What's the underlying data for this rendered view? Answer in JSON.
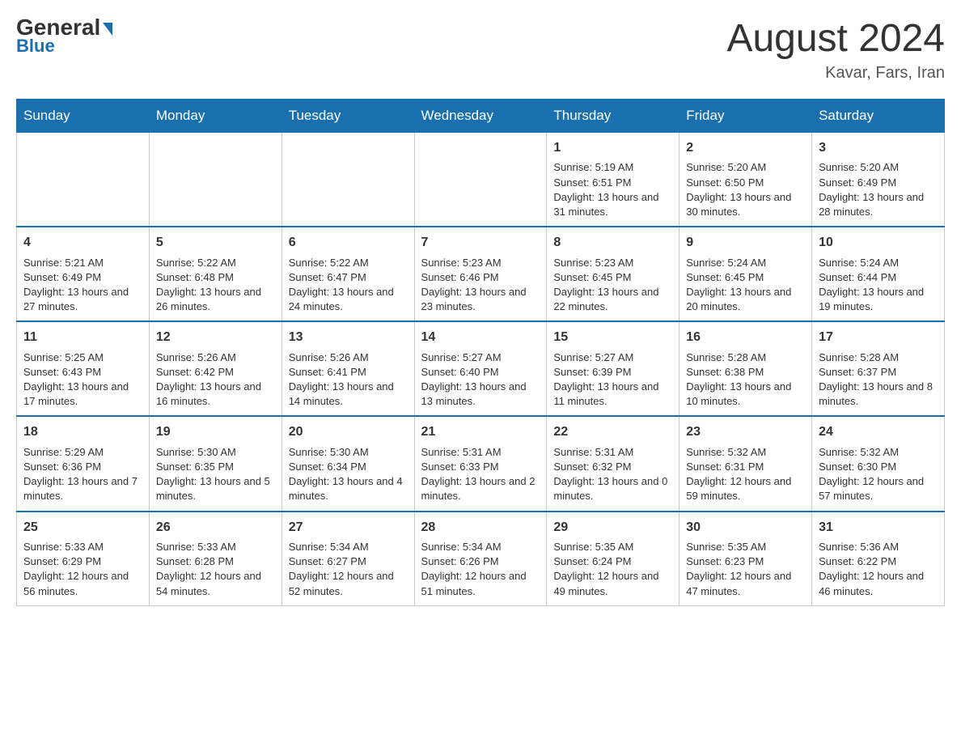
{
  "header": {
    "logo_general": "General",
    "logo_blue": "Blue",
    "month_title": "August 2024",
    "location": "Kavar, Fars, Iran"
  },
  "weekdays": [
    "Sunday",
    "Monday",
    "Tuesday",
    "Wednesday",
    "Thursday",
    "Friday",
    "Saturday"
  ],
  "weeks": [
    [
      {
        "day": "",
        "info": ""
      },
      {
        "day": "",
        "info": ""
      },
      {
        "day": "",
        "info": ""
      },
      {
        "day": "",
        "info": ""
      },
      {
        "day": "1",
        "info": "Sunrise: 5:19 AM\nSunset: 6:51 PM\nDaylight: 13 hours and 31 minutes."
      },
      {
        "day": "2",
        "info": "Sunrise: 5:20 AM\nSunset: 6:50 PM\nDaylight: 13 hours and 30 minutes."
      },
      {
        "day": "3",
        "info": "Sunrise: 5:20 AM\nSunset: 6:49 PM\nDaylight: 13 hours and 28 minutes."
      }
    ],
    [
      {
        "day": "4",
        "info": "Sunrise: 5:21 AM\nSunset: 6:49 PM\nDaylight: 13 hours and 27 minutes."
      },
      {
        "day": "5",
        "info": "Sunrise: 5:22 AM\nSunset: 6:48 PM\nDaylight: 13 hours and 26 minutes."
      },
      {
        "day": "6",
        "info": "Sunrise: 5:22 AM\nSunset: 6:47 PM\nDaylight: 13 hours and 24 minutes."
      },
      {
        "day": "7",
        "info": "Sunrise: 5:23 AM\nSunset: 6:46 PM\nDaylight: 13 hours and 23 minutes."
      },
      {
        "day": "8",
        "info": "Sunrise: 5:23 AM\nSunset: 6:45 PM\nDaylight: 13 hours and 22 minutes."
      },
      {
        "day": "9",
        "info": "Sunrise: 5:24 AM\nSunset: 6:45 PM\nDaylight: 13 hours and 20 minutes."
      },
      {
        "day": "10",
        "info": "Sunrise: 5:24 AM\nSunset: 6:44 PM\nDaylight: 13 hours and 19 minutes."
      }
    ],
    [
      {
        "day": "11",
        "info": "Sunrise: 5:25 AM\nSunset: 6:43 PM\nDaylight: 13 hours and 17 minutes."
      },
      {
        "day": "12",
        "info": "Sunrise: 5:26 AM\nSunset: 6:42 PM\nDaylight: 13 hours and 16 minutes."
      },
      {
        "day": "13",
        "info": "Sunrise: 5:26 AM\nSunset: 6:41 PM\nDaylight: 13 hours and 14 minutes."
      },
      {
        "day": "14",
        "info": "Sunrise: 5:27 AM\nSunset: 6:40 PM\nDaylight: 13 hours and 13 minutes."
      },
      {
        "day": "15",
        "info": "Sunrise: 5:27 AM\nSunset: 6:39 PM\nDaylight: 13 hours and 11 minutes."
      },
      {
        "day": "16",
        "info": "Sunrise: 5:28 AM\nSunset: 6:38 PM\nDaylight: 13 hours and 10 minutes."
      },
      {
        "day": "17",
        "info": "Sunrise: 5:28 AM\nSunset: 6:37 PM\nDaylight: 13 hours and 8 minutes."
      }
    ],
    [
      {
        "day": "18",
        "info": "Sunrise: 5:29 AM\nSunset: 6:36 PM\nDaylight: 13 hours and 7 minutes."
      },
      {
        "day": "19",
        "info": "Sunrise: 5:30 AM\nSunset: 6:35 PM\nDaylight: 13 hours and 5 minutes."
      },
      {
        "day": "20",
        "info": "Sunrise: 5:30 AM\nSunset: 6:34 PM\nDaylight: 13 hours and 4 minutes."
      },
      {
        "day": "21",
        "info": "Sunrise: 5:31 AM\nSunset: 6:33 PM\nDaylight: 13 hours and 2 minutes."
      },
      {
        "day": "22",
        "info": "Sunrise: 5:31 AM\nSunset: 6:32 PM\nDaylight: 13 hours and 0 minutes."
      },
      {
        "day": "23",
        "info": "Sunrise: 5:32 AM\nSunset: 6:31 PM\nDaylight: 12 hours and 59 minutes."
      },
      {
        "day": "24",
        "info": "Sunrise: 5:32 AM\nSunset: 6:30 PM\nDaylight: 12 hours and 57 minutes."
      }
    ],
    [
      {
        "day": "25",
        "info": "Sunrise: 5:33 AM\nSunset: 6:29 PM\nDaylight: 12 hours and 56 minutes."
      },
      {
        "day": "26",
        "info": "Sunrise: 5:33 AM\nSunset: 6:28 PM\nDaylight: 12 hours and 54 minutes."
      },
      {
        "day": "27",
        "info": "Sunrise: 5:34 AM\nSunset: 6:27 PM\nDaylight: 12 hours and 52 minutes."
      },
      {
        "day": "28",
        "info": "Sunrise: 5:34 AM\nSunset: 6:26 PM\nDaylight: 12 hours and 51 minutes."
      },
      {
        "day": "29",
        "info": "Sunrise: 5:35 AM\nSunset: 6:24 PM\nDaylight: 12 hours and 49 minutes."
      },
      {
        "day": "30",
        "info": "Sunrise: 5:35 AM\nSunset: 6:23 PM\nDaylight: 12 hours and 47 minutes."
      },
      {
        "day": "31",
        "info": "Sunrise: 5:36 AM\nSunset: 6:22 PM\nDaylight: 12 hours and 46 minutes."
      }
    ]
  ]
}
